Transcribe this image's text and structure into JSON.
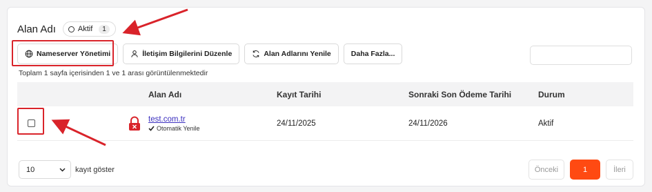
{
  "header": {
    "title": "Alan Adı",
    "status_label": "Aktif",
    "status_count": "1"
  },
  "toolbar": {
    "nameserver_label": "Nameserver Yönetimi",
    "contact_label": "İletişim Bilgilerini Düzenle",
    "renew_label": "Alan Adlarını Yenile",
    "more_label": "Daha Fazla..."
  },
  "search": {
    "placeholder": ""
  },
  "summary": "Toplam 1 sayfa içerisinden 1 ve 1 arası görüntülenmektedir",
  "table": {
    "columns": [
      "Alan Adı",
      "Kayıt Tarihi",
      "Sonraki Son Ödeme Tarihi",
      "Durum"
    ],
    "rows": [
      {
        "domain": "test.com.tr",
        "auto_renew": "Otomatik Yenile",
        "registered": "24/11/2025",
        "next_due": "24/11/2026",
        "status": "Aktif"
      }
    ]
  },
  "footer": {
    "page_size": "10",
    "page_size_label": "kayıt göster",
    "prev_label": "Önceki",
    "current_page": "1",
    "next_label": "İleri"
  },
  "icons": {
    "status": "circle-outline-icon",
    "nameserver": "globe-icon",
    "contact": "user-icon",
    "renew": "refresh-icon",
    "lock": "lock-icon",
    "check": "check-icon",
    "dropdown": "chevron-down-icon"
  },
  "colors": {
    "accent": "#ff4a12",
    "link": "#3b2fbf",
    "lock": "#d9232a",
    "annotation": "#d9232a"
  }
}
